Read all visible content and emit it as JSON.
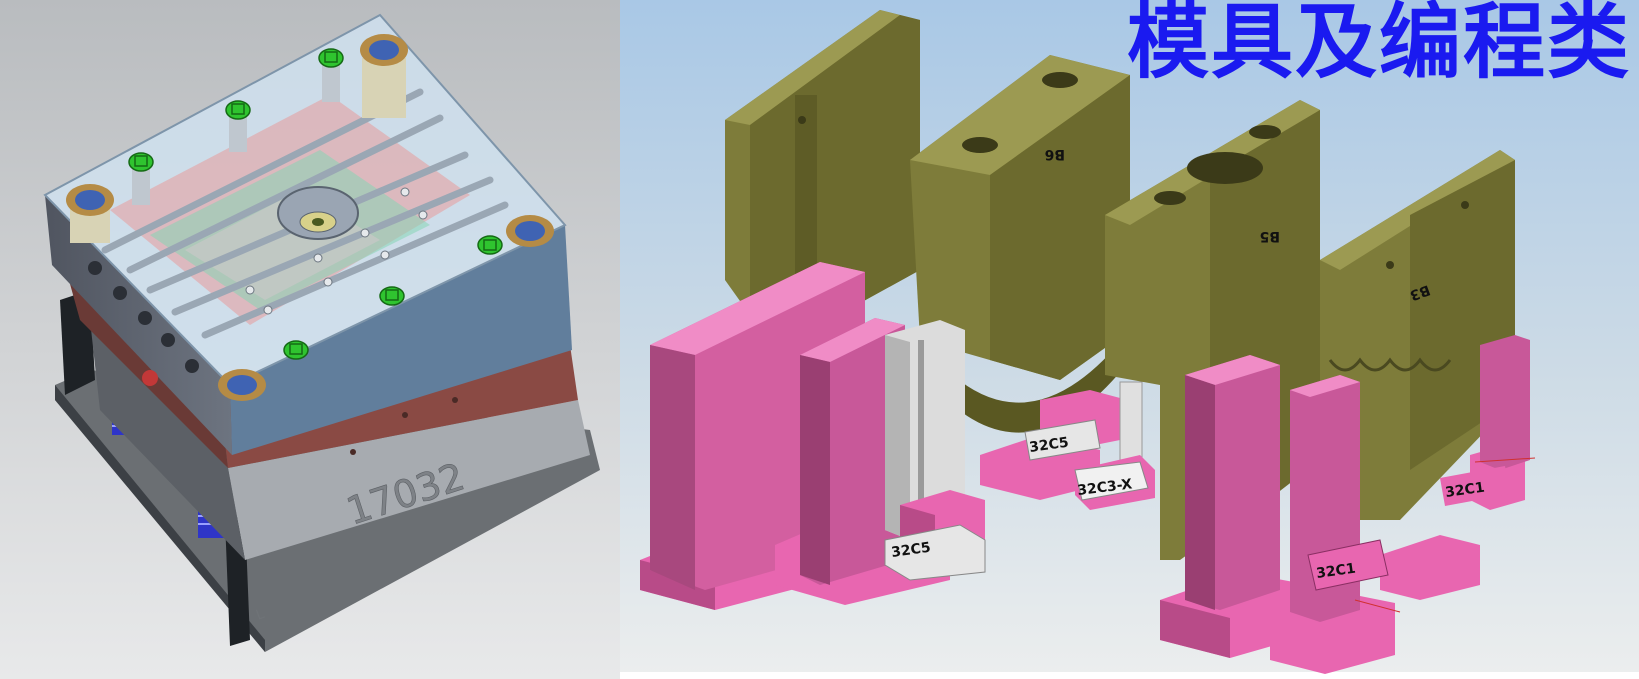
{
  "banner": {
    "title": "模具及编程类"
  },
  "mold_view": {
    "engraved_number": "17032",
    "corner_mark": "L"
  },
  "parts_view": {
    "labels": {
      "c5_left": "32C5",
      "c5_center": "32C5",
      "c3x": "32C3-X",
      "c1_right": "32C1",
      "c1_front": "32C1",
      "b6": "B6",
      "b5": "B5",
      "b3": "B3"
    }
  },
  "colors": {
    "title": "#1a1af0",
    "insert_olive": "#7e7c3a",
    "insert_pink": "#e866b0",
    "fastener_green": "#2fc42f"
  }
}
